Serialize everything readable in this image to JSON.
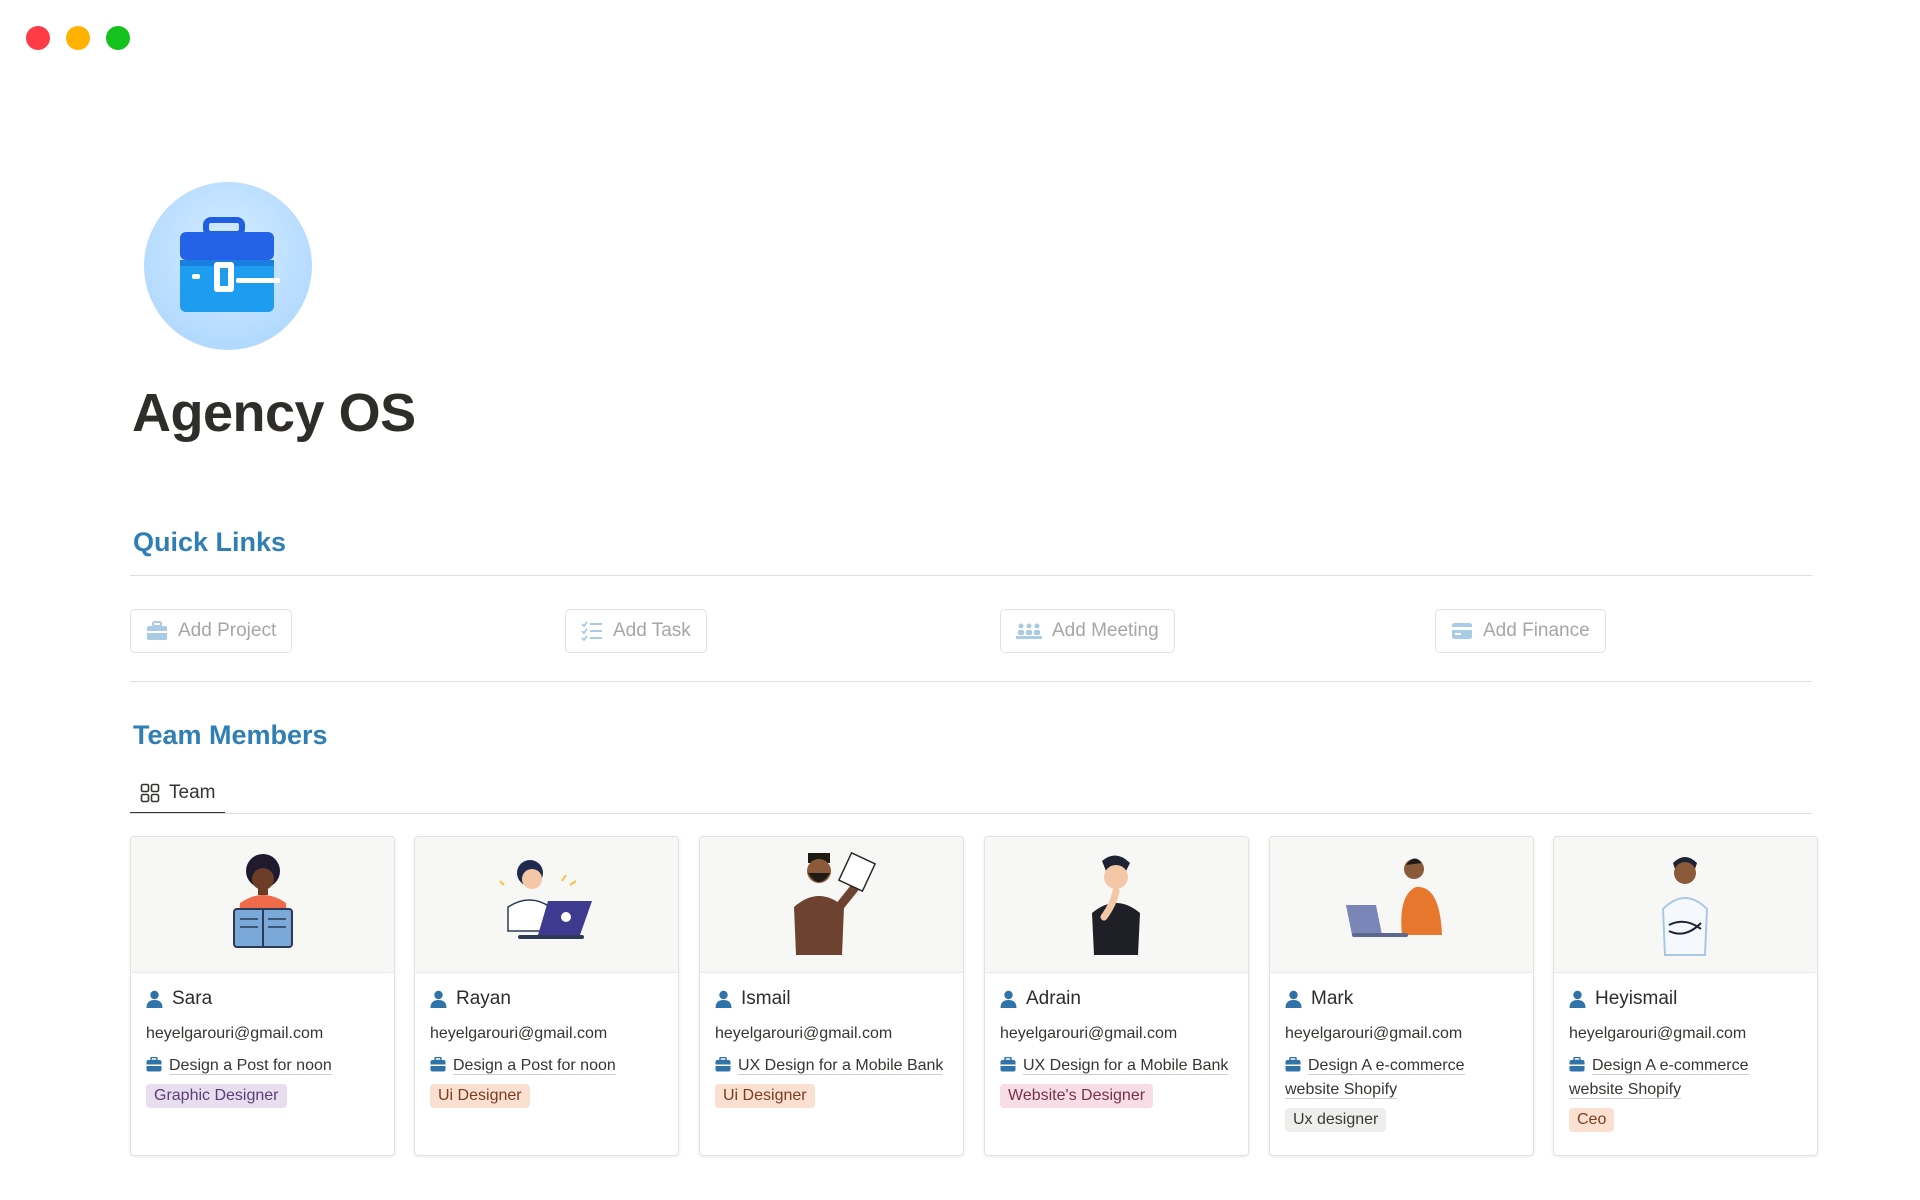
{
  "page": {
    "title": "Agency OS",
    "icon": "briefcase-icon"
  },
  "quick_links": {
    "heading": "Quick Links",
    "buttons": [
      {
        "label": "Add Project",
        "icon": "briefcase-icon"
      },
      {
        "label": "Add Task",
        "icon": "checklist-icon"
      },
      {
        "label": "Add Meeting",
        "icon": "meeting-icon"
      },
      {
        "label": "Add Finance",
        "icon": "credit-card-icon"
      }
    ]
  },
  "team": {
    "heading": "Team Members",
    "view_tab": "Team",
    "members": [
      {
        "name": "Sara",
        "email": "heyelgarouri@gmail.com",
        "project": "Design a Post for noon",
        "role": "Graphic Designer",
        "role_bg": "#e8def0",
        "role_fg": "#5a3e75"
      },
      {
        "name": "Rayan",
        "email": "heyelgarouri@gmail.com",
        "project": "Design a Post for noon",
        "role": "Ui Designer",
        "role_bg": "#fbe0d2",
        "role_fg": "#7a3d1f"
      },
      {
        "name": "Ismail",
        "email": "heyelgarouri@gmail.com",
        "project": "UX Design for a Mobile Bank",
        "role": "Ui Designer",
        "role_bg": "#fbe0d2",
        "role_fg": "#7a3d1f"
      },
      {
        "name": "Adrain",
        "email": "heyelgarouri@gmail.com",
        "project": "UX Design for a Mobile Bank",
        "role": "Website's Designer",
        "role_bg": "#f8dde6",
        "role_fg": "#76324a"
      },
      {
        "name": "Mark",
        "email": "heyelgarouri@gmail.com",
        "project": "Design A e-commerce website Shopify",
        "role": "Ux designer",
        "role_bg": "#eeeeec",
        "role_fg": "#3a3936"
      },
      {
        "name": "Heyismail",
        "email": "heyelgarouri@gmail.com",
        "project": "Design A e-commerce website Shopify",
        "role": "Ceo",
        "role_bg": "#fbe0d2",
        "role_fg": "#7a3d1f"
      }
    ]
  },
  "colors": {
    "accent": "#2f7fb5",
    "icon_blue": "#2f73a8"
  }
}
